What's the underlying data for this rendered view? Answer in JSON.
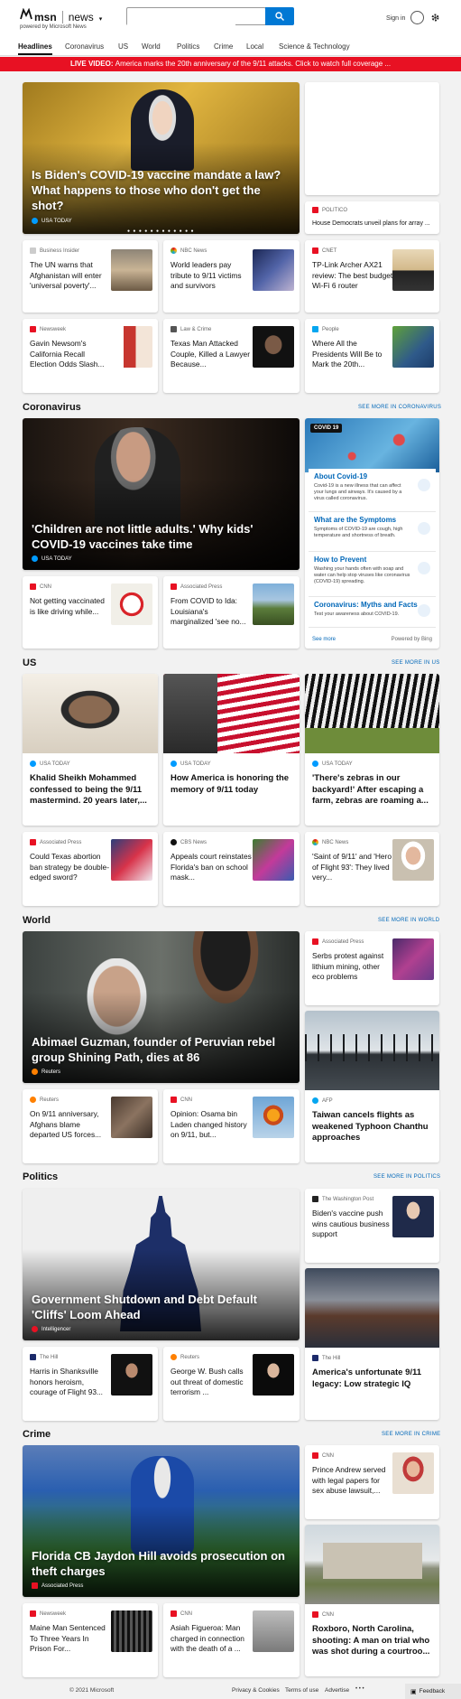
{
  "brand": {
    "logo": "msn",
    "product": "news",
    "powered": "powered by Microsoft News"
  },
  "header": {
    "search_placeholder": "",
    "sign_in": "Sign in"
  },
  "nav": [
    "Headlines",
    "Coronavirus",
    "US",
    "World",
    "Politics",
    "Crime",
    "Local",
    "Science & Technology"
  ],
  "banner": {
    "label": "LIVE VIDEO:",
    "text": "America marks the 20th anniversary of the 9/11 attacks. Click to watch full coverage ..."
  },
  "top": {
    "hero": {
      "title": "Is Biden's COVID-19 vaccine mandate a law? What happens to those who don't get the shot?",
      "source": "USA TODAY"
    },
    "side": {
      "source": "POLITICO",
      "title": "House Democrats unveil plans for array ..."
    },
    "row1": [
      {
        "source": "Business Insider",
        "title": "The UN warns that Afghanistan will enter 'universal poverty'..."
      },
      {
        "source": "NBC News",
        "title": "World leaders pay tribute to 9/11 victims and survivors"
      },
      {
        "source": "CNET",
        "title": "TP-Link Archer AX21 review: The best budget Wi-Fi 6 router"
      }
    ],
    "row2": [
      {
        "source": "Newsweek",
        "title": "Gavin Newsom's California Recall Election Odds Slash..."
      },
      {
        "source": "Law & Crime",
        "title": "Texas Man Attacked Couple, Killed a Lawyer Because..."
      },
      {
        "source": "People",
        "title": "Where All the Presidents Will Be to Mark the 20th..."
      }
    ]
  },
  "coronavirus": {
    "title": "Coronavirus",
    "see_more": "SEE MORE IN CORONAVIRUS",
    "hero": {
      "title": "'Children are not little adults.' Why kids' COVID-19 vaccines take time",
      "source": "USA TODAY"
    },
    "small": [
      {
        "source": "CNN",
        "title": "Not getting vaccinated is like driving while..."
      },
      {
        "source": "Associated Press",
        "title": "From COVID to Ida: Louisiana's marginalized 'see no..."
      }
    ],
    "panel": {
      "badge": "COVID 19",
      "rows": [
        {
          "h": "About Covid-19",
          "d": "Covid-19 is a new illness that can affect your lungs and airways. It's caused by a virus called coronavirus."
        },
        {
          "h": "What are the Symptoms",
          "d": "Symptoms of COVID-19 are cough, high temperature and shortness of breath."
        },
        {
          "h": "How to Prevent",
          "d": "Washing your hands often with soap and water can help stop viruses like coronavirus (COVID-19) spreading."
        },
        {
          "h": "Coronavirus: Myths and Facts",
          "d": "Test your awareness about COVID-19."
        }
      ],
      "see_more": "See more",
      "powered": "Powered by Bing"
    }
  },
  "us": {
    "title": "US",
    "see_more": "SEE MORE IN US",
    "big": [
      {
        "source": "USA TODAY",
        "title": "Khalid Sheikh Mohammed confessed to being the 9/11 mastermind. 20 years later,..."
      },
      {
        "source": "USA TODAY",
        "title": "How America is honoring the memory of 9/11 today"
      },
      {
        "source": "USA TODAY",
        "title": "'There's zebras in our backyard!' After escaping a farm, zebras are roaming a..."
      }
    ],
    "small": [
      {
        "source": "Associated Press",
        "title": "Could Texas abortion ban strategy be double-edged sword?"
      },
      {
        "source": "CBS News",
        "title": "Appeals court reinstates Florida's ban on school mask..."
      },
      {
        "source": "NBC News",
        "title": "'Saint of 9/11' and 'Hero of Flight 93': They lived very..."
      }
    ]
  },
  "world": {
    "title": "World",
    "see_more": "SEE MORE IN WORLD",
    "hero": {
      "title": "Abimael Guzman, founder of Peruvian rebel group Shining Path, dies at 86",
      "source": "Reuters"
    },
    "side1": {
      "source": "Associated Press",
      "title": "Serbs protest against lithium mining, other eco problems"
    },
    "side2": {
      "source": "AFP",
      "title": "Taiwan cancels flights as weakened Typhoon Chanthu approaches"
    },
    "small": [
      {
        "source": "Reuters",
        "title": "On 9/11 anniversary, Afghans blame departed US forces..."
      },
      {
        "source": "CNN",
        "title": "Opinion: Osama bin Laden changed history on 9/11, but..."
      }
    ]
  },
  "politics": {
    "title": "Politics",
    "see_more": "SEE MORE IN POLITICS",
    "hero": {
      "title": "Government Shutdown and Debt Default 'Cliffs' Loom Ahead",
      "source": "Intelligencer"
    },
    "side1": {
      "source": "The Washington Post",
      "title": "Biden's vaccine push wins cautious business support"
    },
    "side2": {
      "source": "The Hill",
      "title": "America's unfortunate 9/11 legacy: Low strategic IQ"
    },
    "small": [
      {
        "source": "The Hill",
        "title": "Harris in Shanksville honors heroism, courage of Flight 93..."
      },
      {
        "source": "Reuters",
        "title": "George W. Bush calls out threat of domestic terrorism ..."
      }
    ]
  },
  "crime": {
    "title": "Crime",
    "see_more": "SEE MORE IN CRIME",
    "hero": {
      "title": "Florida CB Jaydon Hill avoids prosecution on theft charges",
      "source": "Associated Press"
    },
    "side1": {
      "source": "CNN",
      "title": "Prince Andrew served with legal papers for sex abuse lawsuit,..."
    },
    "side2": {
      "source": "CNN",
      "title": "Roxboro, North Carolina, shooting: A man on trial who was shot during a courtroo..."
    },
    "small": [
      {
        "source": "Newsweek",
        "title": "Maine Man Sentenced To Three Years In Prison For..."
      },
      {
        "source": "CNN",
        "title": "Asiah Figueroa: Man charged in connection with the death of a ..."
      }
    ]
  },
  "footer": {
    "copyright": "© 2021 Microsoft",
    "links": [
      "Privacy & Cookies",
      "Terms of use",
      "Advertise"
    ],
    "more": "• • •",
    "feedback": "Feedback"
  }
}
